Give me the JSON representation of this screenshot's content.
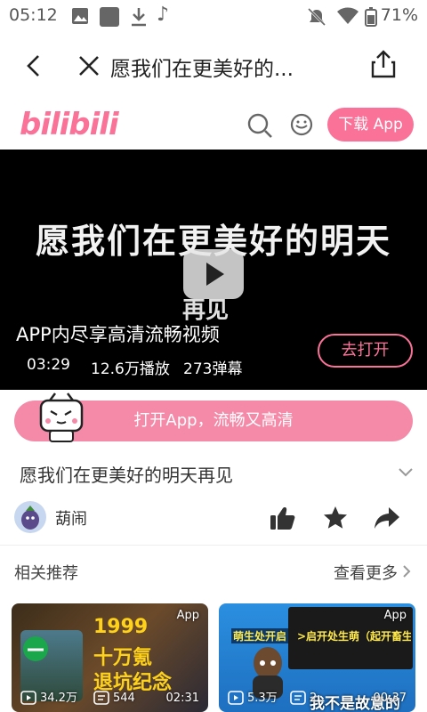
{
  "status_bar": {
    "time": "05:12",
    "battery": "71%"
  },
  "nav": {
    "title": "愿我们在更美好的..."
  },
  "brand": {
    "logo": "bilibili",
    "download_label": "下载 App",
    "accent": "#fb7299"
  },
  "video": {
    "overlay_text": "愿我们在更美好的明天",
    "overlay_text2": "再见",
    "promo": "APP内尽享高清流畅视频",
    "duration": "03:29",
    "plays": "12.6万播放",
    "danmaku": "273弹幕",
    "open_label": "去打开"
  },
  "banner": {
    "label": "打开App，流畅又高清"
  },
  "detail": {
    "title": "愿我们在更美好的明天再见",
    "uploader": "葫闹"
  },
  "related": {
    "title": "相关推荐",
    "more": "查看更多",
    "cards": [
      {
        "tag": "App",
        "views": "34.2万",
        "danmaku": "544",
        "duration": "02:31",
        "cover_text": [
          "1999",
          "十万氪",
          "退坑纪念"
        ]
      },
      {
        "tag": "App",
        "views": "5.3万",
        "danmaku": "2",
        "duration": "00:37",
        "cover_text": [
          "萌生处开启",
          ">启开处生萌（起开畜生们）",
          "我不是故意的"
        ]
      }
    ]
  }
}
